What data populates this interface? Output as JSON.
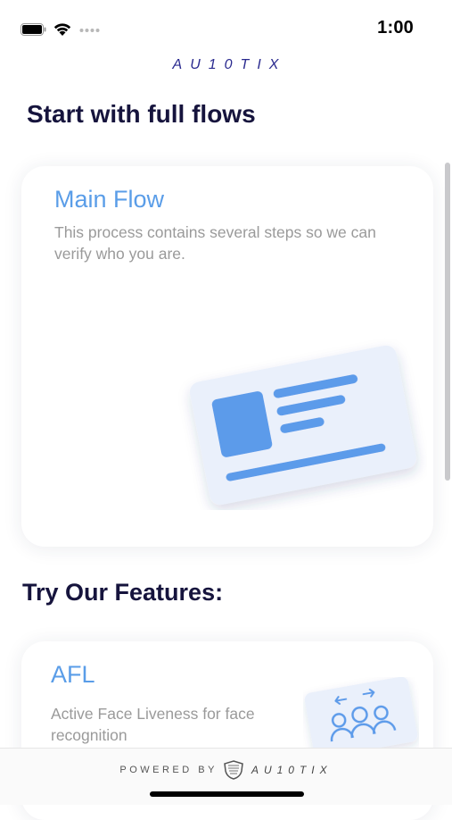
{
  "status_bar": {
    "time": "1:00",
    "battery_icon": "battery-full-icon",
    "wifi_icon": "wifi-icon",
    "signal_icon": "no-signal-dots-icon"
  },
  "header": {
    "logo_text": "AU10TIX"
  },
  "full_flows": {
    "heading": "Start with full flows",
    "cards": [
      {
        "title": "Main Flow",
        "description": "This process contains several steps so we can verify who you are.",
        "illustration": "id-card-icon"
      }
    ]
  },
  "features": {
    "heading": "Try Our Features:",
    "cards": [
      {
        "title": "AFL",
        "description": "Active Face Liveness for face recognition",
        "illustration": "face-liveness-icon"
      }
    ]
  },
  "footer": {
    "powered_by": "POWERED BY",
    "logo_text": "AU10TIX",
    "shield_icon": "shield-logo-icon"
  },
  "colors": {
    "brand_navy": "#16143d",
    "accent_blue": "#5a9de8",
    "muted_text": "#9a9a9a",
    "logo_blue": "#2a2a8f"
  }
}
